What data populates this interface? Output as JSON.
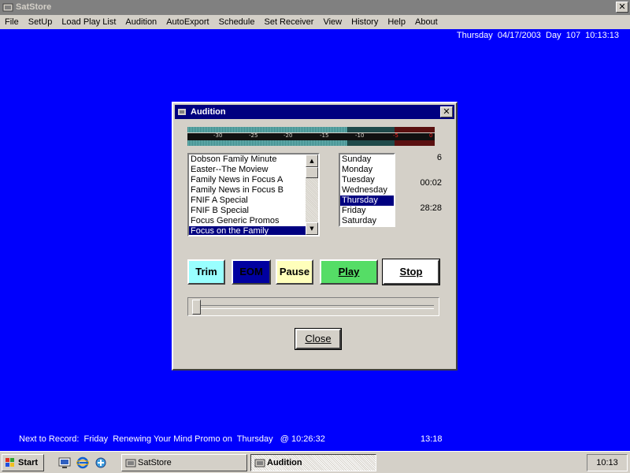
{
  "window": {
    "title": "SatStore",
    "close_glyph": "✕"
  },
  "menu": [
    "File",
    "SetUp",
    "Load Play List",
    "Audition",
    "AutoExport",
    "Schedule",
    "Set Receiver",
    "View",
    "History",
    "Help",
    "About"
  ],
  "datebar": {
    "text": "Thursday  04/17/2003  Day  107  10:13:13"
  },
  "dialog": {
    "title": "Audition",
    "close_glyph": "✕",
    "meter_scale": [
      "-30",
      "-25",
      "-20",
      "-15",
      "-10",
      "-5",
      "0"
    ],
    "programs": [
      "Dobson Family Minute",
      "Easter--The Moview",
      "Family News in Focus  A",
      "Family News in Focus B",
      "FNIF A Special",
      "FNIF B Special",
      "Focus Generic Promos",
      "Focus on the Family"
    ],
    "selected_program": "Focus on the Family",
    "days": [
      "Sunday",
      "Monday",
      "Tuesday",
      "Wednesday",
      "Thursday",
      "Friday",
      "Saturday"
    ],
    "selected_day": "Thursday",
    "info": {
      "count": "6",
      "position": "00:02",
      "length": "28:28"
    },
    "buttons": {
      "trim": "Trim",
      "eom": "EOM",
      "pause": "Pause",
      "play": "Play",
      "stop": "Stop",
      "close": "Close"
    },
    "colors": {
      "trim": "#99ffff",
      "eom": "#0000a0",
      "pause": "#ffffbb",
      "play": "#55dd66",
      "stop": "#ffffff"
    },
    "slider_position": 0
  },
  "status": {
    "next_record": "Next to Record:  Friday  Renewing Your Mind Promo on  Thursday   @ 10:26:32",
    "time": "13:18"
  },
  "taskbar": {
    "start": "Start",
    "tasks": [
      "SatStore",
      "Audition"
    ],
    "active_task": "Audition",
    "clock": "10:13",
    "quick_launch_icons": [
      "show-desktop-icon",
      "internet-explorer-icon",
      "channels-icon"
    ]
  }
}
